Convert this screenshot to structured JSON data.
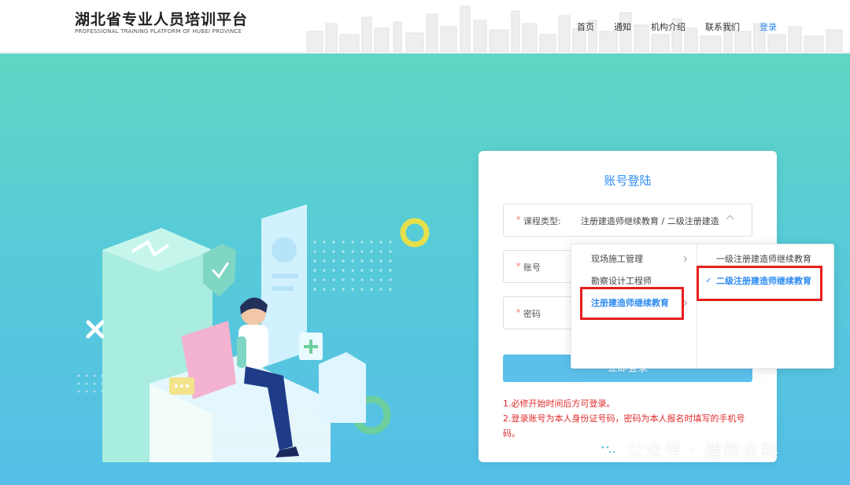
{
  "header": {
    "title": "湖北省专业人员培训平台",
    "subtitle": "PROFESSIONAL TRAINING PLATFORM OF HUBEI PROVINCE",
    "nav": [
      "首页",
      "通知",
      "机构介绍",
      "联系我们",
      "登录"
    ],
    "active_nav": "登录"
  },
  "login": {
    "title": "账号登陆",
    "required_mark": "*",
    "course_type_label": "课程类型:",
    "course_type_value": "注册建造师继续教育 / 二级注册建造",
    "account_label": "账号",
    "password_label": "密码",
    "submit_label": "立即登录",
    "notes": [
      "1.必修开始时间后方可登录。",
      "2.登录账号为本人身份证号码，密码为本人报名时填写的手机号码。"
    ]
  },
  "cascader": {
    "level1": [
      "现场施工管理",
      "勘察设计工程师",
      "注册建造师继续教育"
    ],
    "level1_active": "注册建造师继续教育",
    "level2": [
      "一级注册建造师继续教育",
      "二级注册建造师继续教育"
    ],
    "level2_selected": "二级注册建造师继续教育",
    "check_mark": "✓"
  },
  "watermark": {
    "text": "公众号 · 建筑全科",
    "icon": "wechat-icon"
  },
  "colors": {
    "accent": "#2d8cf0",
    "highlight_border": "#e81e1e",
    "notes": "#e02b2b",
    "button": "#5cc0ec"
  }
}
